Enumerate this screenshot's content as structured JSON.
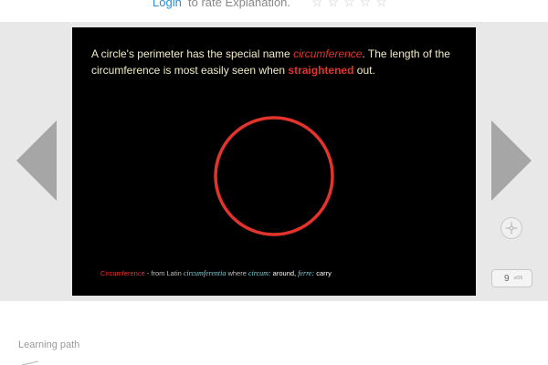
{
  "rating": {
    "login_label": "Login",
    "rate_text": "to rate Explanation.",
    "stars": [
      "☆",
      "☆",
      "☆",
      "☆",
      "☆"
    ]
  },
  "navigation": {
    "prev_icon": "left-arrow-icon",
    "next_icon": "right-arrow-icon"
  },
  "slide": {
    "text_part1": "A circle's perimeter has the special name ",
    "highlight_term": "circumference",
    "text_part2": ". The length of the circumference is most easily seen when ",
    "highlight_action": "straightened",
    "text_part3": " out.",
    "circle_color": "#e3332c",
    "etymology": {
      "term": "Circumference",
      "from": " - from Latin ",
      "latin": "circumferentia",
      "where": " where ",
      "circum": "circum:",
      "around": " around, ",
      "ferre": "ferre:",
      "carry": " carry"
    }
  },
  "controls": {
    "compass_icon": "compass-icon",
    "page_number": "9",
    "page_unit": "of26"
  },
  "learning_path": {
    "label": "Learning path"
  },
  "colors": {
    "accent": "#e3332c",
    "link": "#2a8fd0",
    "stage_bg": "#e8e8e8",
    "slide_bg": "#000000"
  }
}
